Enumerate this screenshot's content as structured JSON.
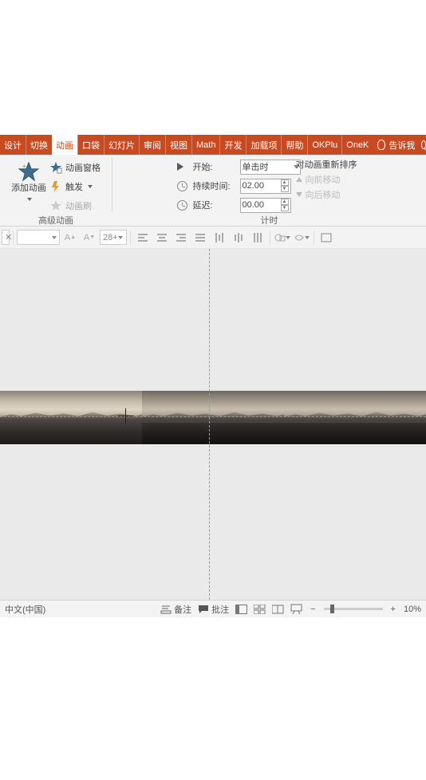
{
  "tabs": {
    "design": "设计",
    "transition": "切换",
    "animation": "动画",
    "pocket": "口袋",
    "slideshow": "幻灯片",
    "review": "审阅",
    "view": "视图",
    "math": "Math",
    "developer": "开发",
    "addins": "加载项",
    "help": "帮助",
    "okplus": "OKPlu",
    "onek": "OneK",
    "tellme": "告诉我"
  },
  "ribbon": {
    "add_animation": "添加动画",
    "animation_pane": "动画窗格",
    "trigger": "触发",
    "painter": "动画刷",
    "group_advanced": "高级动画",
    "start_label": "开始:",
    "start_value": "单击时",
    "duration_label": "持续时间:",
    "duration_value": "02.00",
    "delay_label": "延迟:",
    "delay_value": "00.00",
    "group_timing": "计时",
    "reorder_title": "对动画重新排序",
    "move_earlier": "向前移动",
    "move_later": "向后移动"
  },
  "toolbar2": {
    "fontsize": "28+"
  },
  "status": {
    "lang": "中文(中国)",
    "notes": "备注",
    "comments": "批注",
    "zoom": "10%"
  }
}
